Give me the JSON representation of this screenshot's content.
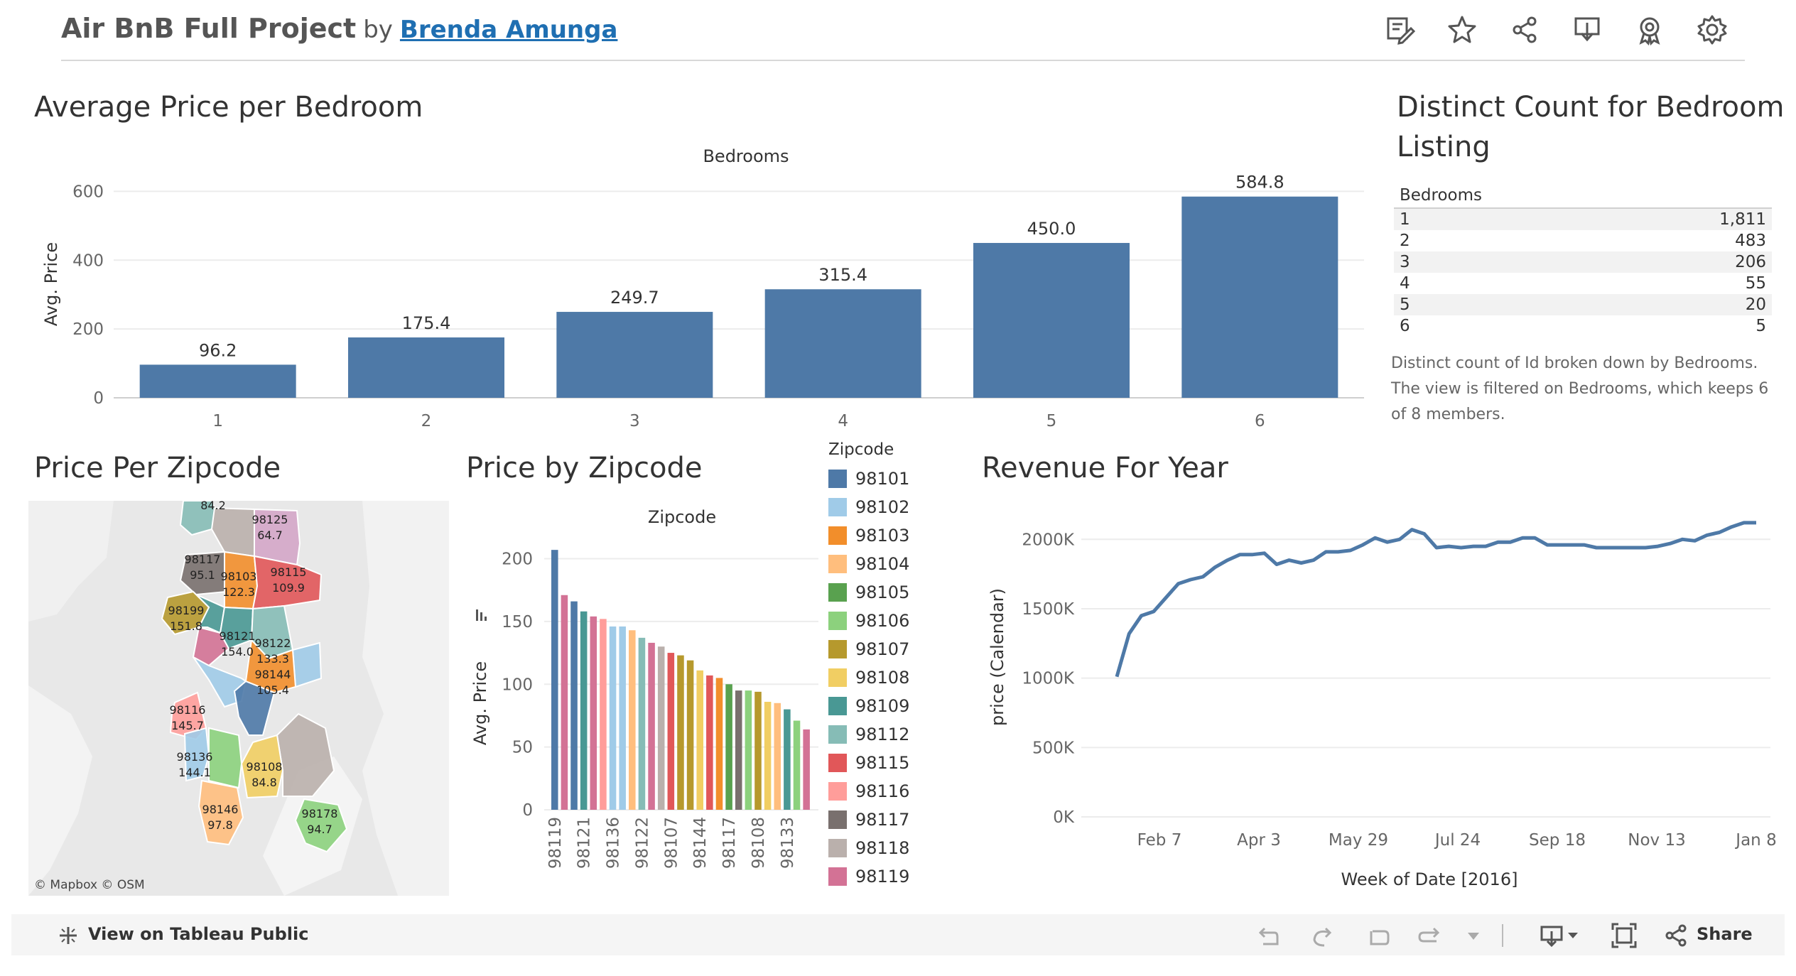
{
  "header": {
    "title": "Air BnB Full Project",
    "by": "by",
    "author": "Brenda Amunga",
    "icons": [
      "edit-icon",
      "star-icon",
      "share-icon",
      "download-icon",
      "badge-icon",
      "settings-icon"
    ]
  },
  "avg_price_panel": {
    "heading": "Average Price per Bedroom"
  },
  "distinct_panel": {
    "heading_line1": "Distinct Count for Bedroom",
    "heading_line2": "Listing",
    "column_header": "Bedrooms",
    "rows": [
      {
        "bedrooms": "1",
        "count": "1,811"
      },
      {
        "bedrooms": "2",
        "count": "483"
      },
      {
        "bedrooms": "3",
        "count": "206"
      },
      {
        "bedrooms": "4",
        "count": "55"
      },
      {
        "bedrooms": "5",
        "count": "20"
      },
      {
        "bedrooms": "6",
        "count": "5"
      }
    ],
    "caption": "Distinct count of Id broken down by Bedrooms. The view is filtered on Bedrooms, which keeps 6 of 8 members."
  },
  "map_panel": {
    "heading": "Price Per Zipcode",
    "attribution": "© Mapbox  © OSM",
    "regions": [
      {
        "zip": "",
        "price": "84.2",
        "color": "#86bcb6"
      },
      {
        "zip": "98125",
        "price": "64.7",
        "color": "#d4a6c8"
      },
      {
        "zip": "98117",
        "price": "95.1",
        "color": "#79706e"
      },
      {
        "zip": "98103",
        "price": "122.3",
        "color": "#f28e2b"
      },
      {
        "zip": "98115",
        "price": "109.9",
        "color": "#e15759"
      },
      {
        "zip": "98199",
        "price": "151.8",
        "color": "#b6992d"
      },
      {
        "zip": "98121",
        "price": "154.0",
        "color": "#499894"
      },
      {
        "zip": "98122",
        "price": "133.3",
        "color": "#86bcb6"
      },
      {
        "zip": "98144",
        "price": "105.4",
        "color": "#f28e2b"
      },
      {
        "zip": "98116",
        "price": "145.7",
        "color": "#ff9d9a"
      },
      {
        "zip": "98136",
        "price": "144.1",
        "color": "#a0cbe8"
      },
      {
        "zip": "98108",
        "price": "84.8",
        "color": "#f1ce63"
      },
      {
        "zip": "98146",
        "price": "97.8",
        "color": "#ffbe7d"
      },
      {
        "zip": "98178",
        "price": "94.7",
        "color": "#8cd17d"
      }
    ]
  },
  "zip_bar_panel": {
    "heading": "Price by Zipcode"
  },
  "legend": {
    "title": "Zipcode",
    "items": [
      {
        "zip": "98101",
        "color": "#4e79a7"
      },
      {
        "zip": "98102",
        "color": "#a0cbe8"
      },
      {
        "zip": "98103",
        "color": "#f28e2b"
      },
      {
        "zip": "98104",
        "color": "#ffbe7d"
      },
      {
        "zip": "98105",
        "color": "#59a14f"
      },
      {
        "zip": "98106",
        "color": "#8cd17d"
      },
      {
        "zip": "98107",
        "color": "#b6992d"
      },
      {
        "zip": "98108",
        "color": "#f1ce63"
      },
      {
        "zip": "98109",
        "color": "#499894"
      },
      {
        "zip": "98112",
        "color": "#86bcb6"
      },
      {
        "zip": "98115",
        "color": "#e15759"
      },
      {
        "zip": "98116",
        "color": "#ff9d9a"
      },
      {
        "zip": "98117",
        "color": "#79706e"
      },
      {
        "zip": "98118",
        "color": "#bab0ac"
      },
      {
        "zip": "98119",
        "color": "#d37295"
      }
    ]
  },
  "revenue_panel": {
    "heading": "Revenue For Year"
  },
  "footer": {
    "view_label": "View on Tableau Public",
    "share_label": "Share"
  },
  "chart_data": [
    {
      "type": "bar",
      "title": "Bedrooms",
      "categories": [
        "1",
        "2",
        "3",
        "4",
        "5",
        "6"
      ],
      "values": [
        96.2,
        175.4,
        249.7,
        315.4,
        450.0,
        584.8
      ],
      "value_labels": [
        "96.2",
        "175.4",
        "249.7",
        "315.4",
        "450.0",
        "584.8"
      ],
      "ylabel": "Avg. Price",
      "xlabel": "",
      "yticks": [
        "0",
        "200",
        "400",
        "600"
      ],
      "ylim": [
        0,
        640
      ],
      "color": "#4e79a7",
      "grid": true
    },
    {
      "type": "bar",
      "title": "Zipcode",
      "ylabel": "Avg. Price",
      "xlabel": "",
      "yticks": [
        "0",
        "50",
        "100",
        "150",
        "200"
      ],
      "ylim": [
        0,
        215
      ],
      "tick_labels": [
        "98119",
        "98121",
        "98136",
        "98122",
        "98107",
        "98144",
        "98117",
        "98108",
        "98133"
      ],
      "values": [
        207,
        171,
        166,
        158,
        154,
        152,
        146,
        146,
        143,
        137,
        133,
        130,
        125,
        123,
        119,
        111,
        107,
        105,
        100,
        95,
        95,
        94,
        86,
        85,
        80,
        71,
        64
      ],
      "colors": [
        "#4e79a7",
        "#d37295",
        "#4e79a7",
        "#499894",
        "#d37295",
        "#ff9d9a",
        "#a0cbe8",
        "#a0cbe8",
        "#ffbe7d",
        "#86bcb6",
        "#d37295",
        "#bab0ac",
        "#e15759",
        "#b6992d",
        "#b6992d",
        "#f1ce63",
        "#e15759",
        "#f28e2b",
        "#59a14f",
        "#79706e",
        "#8cd17d",
        "#b6992d",
        "#f1ce63",
        "#ffbe7d",
        "#499894",
        "#8cd17d",
        "#d37295"
      ],
      "grid": true
    },
    {
      "type": "line",
      "xlabel": "Week of Date [2016]",
      "ylabel": "price (Calendar)",
      "x_ticks": [
        "Feb 7",
        "Apr 3",
        "May 29",
        "Jul 24",
        "Sep 18",
        "Nov 13",
        "Jan 8"
      ],
      "yticks": [
        "0K",
        "500K",
        "1000K",
        "1500K",
        "2000K"
      ],
      "ylim": [
        0,
        2150000
      ],
      "x": [
        "2016-01-03",
        "2016-01-10",
        "2016-01-17",
        "2016-01-24",
        "2016-01-31",
        "2016-02-07",
        "2016-02-14",
        "2016-02-21",
        "2016-02-28",
        "2016-03-06",
        "2016-03-13",
        "2016-03-20",
        "2016-03-27",
        "2016-04-03",
        "2016-04-10",
        "2016-04-17",
        "2016-04-24",
        "2016-05-01",
        "2016-05-08",
        "2016-05-15",
        "2016-05-22",
        "2016-05-29",
        "2016-06-05",
        "2016-06-12",
        "2016-06-19",
        "2016-06-26",
        "2016-07-03",
        "2016-07-10",
        "2016-07-17",
        "2016-07-24",
        "2016-07-31",
        "2016-08-07",
        "2016-08-14",
        "2016-08-21",
        "2016-08-28",
        "2016-09-04",
        "2016-09-11",
        "2016-09-18",
        "2016-09-25",
        "2016-10-02",
        "2016-10-09",
        "2016-10-16",
        "2016-10-23",
        "2016-10-30",
        "2016-11-06",
        "2016-11-13",
        "2016-11-20",
        "2016-11-27",
        "2016-12-04",
        "2016-12-11",
        "2016-12-18",
        "2016-12-25",
        "2017-01-01"
      ],
      "y": [
        1010000,
        1320000,
        1450000,
        1480000,
        1580000,
        1680000,
        1710000,
        1730000,
        1800000,
        1850000,
        1890000,
        1890000,
        1900000,
        1820000,
        1850000,
        1830000,
        1850000,
        1910000,
        1910000,
        1920000,
        1960000,
        2010000,
        1980000,
        2000000,
        2070000,
        2040000,
        1940000,
        1950000,
        1940000,
        1950000,
        1950000,
        1980000,
        1980000,
        2010000,
        2010000,
        1960000,
        1960000,
        1960000,
        1960000,
        1940000,
        1940000,
        1940000,
        1940000,
        1940000,
        1950000,
        1970000,
        2000000,
        1990000,
        2030000,
        2050000,
        2090000,
        2120000,
        2120000
      ],
      "color": "#4e79a7",
      "grid": true
    }
  ]
}
